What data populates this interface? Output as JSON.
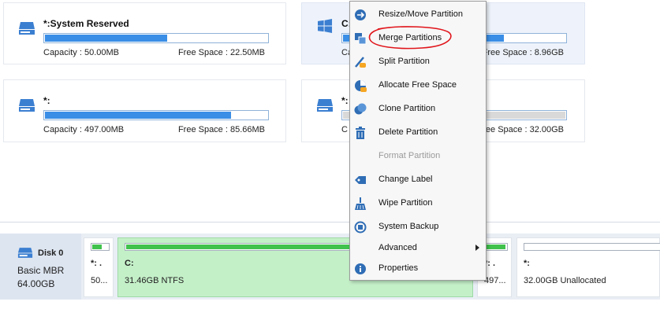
{
  "partitions_top": [
    {
      "title": "*:System Reserved",
      "capacity": "Capacity : 50.00MB",
      "free_space": "Free Space : 22.50MB",
      "used_fraction": 0.55
    },
    {
      "title": "C:",
      "capacity": "Ca",
      "free_space": "Free Space : 8.96GB",
      "used_fraction": 0.72
    },
    {
      "title": "*:",
      "capacity": "Capacity : 497.00MB",
      "free_space": "Free Space : 85.66MB",
      "used_fraction": 0.83
    },
    {
      "title": "*:",
      "capacity": "C",
      "free_space": "Free Space : 32.00GB",
      "used_fraction": 0.0
    }
  ],
  "disk": {
    "name": "Disk 0",
    "type": "Basic MBR",
    "size": "64.00GB",
    "partitions": [
      {
        "label": "*: .",
        "desc": "50...",
        "used_fraction": 0.55
      },
      {
        "label": "C:",
        "desc": "31.46GB NTFS",
        "used_fraction": 0.72
      },
      {
        "label": "*: .",
        "desc": "497...",
        "used_fraction": 0.83
      },
      {
        "label": "*:",
        "desc": "32.00GB Unallocated",
        "used_fraction": 0.0
      }
    ]
  },
  "context_menu": {
    "items": [
      {
        "label": "Resize/Move Partition",
        "icon": "resize-icon",
        "enabled": true
      },
      {
        "label": "Merge Partitions",
        "icon": "merge-icon",
        "enabled": true
      },
      {
        "label": "Split Partition",
        "icon": "split-icon",
        "enabled": true
      },
      {
        "label": "Allocate Free Space",
        "icon": "allocate-icon",
        "enabled": true
      },
      {
        "label": "Clone Partition",
        "icon": "clone-icon",
        "enabled": true
      },
      {
        "label": "Delete Partition",
        "icon": "delete-icon",
        "enabled": true
      },
      {
        "label": "Format Partition",
        "icon": "format-icon",
        "enabled": false
      },
      {
        "label": "Change Label",
        "icon": "label-tag-icon",
        "enabled": true
      },
      {
        "label": "Wipe Partition",
        "icon": "wipe-icon",
        "enabled": true
      },
      {
        "label": "System Backup",
        "icon": "backup-icon",
        "enabled": true
      },
      {
        "label": "Advanced",
        "icon": "",
        "enabled": true,
        "submenu": true
      },
      {
        "label": "Properties",
        "icon": "info-icon",
        "enabled": true
      }
    ]
  },
  "colors": {
    "bar_fill": "#3a8ee6",
    "disk_bar_fill": "#41c24d",
    "annotation": "#e0151b",
    "menu_icon": "#2f6db5"
  }
}
